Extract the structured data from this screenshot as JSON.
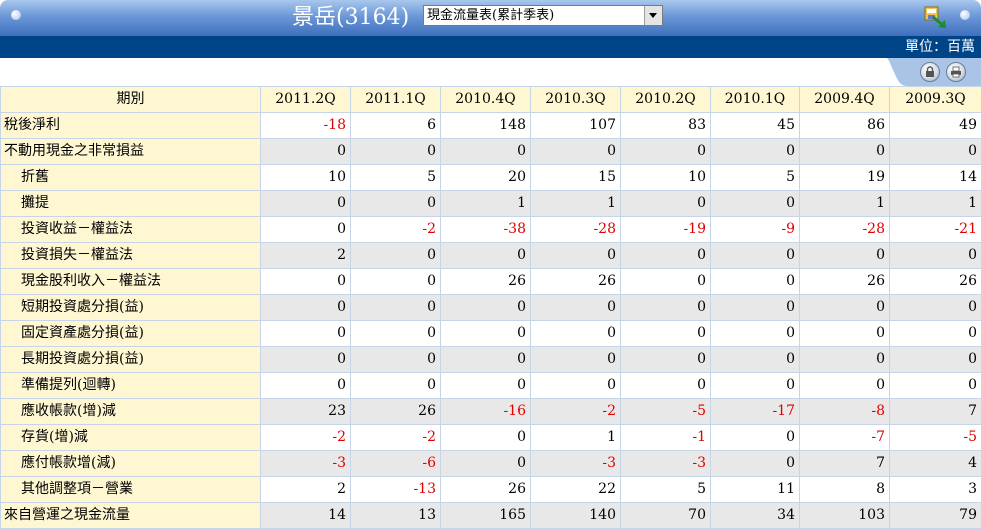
{
  "header": {
    "title": "景岳(3164)",
    "report_select": "現金流量表(累計季表)",
    "unit": "單位：百萬"
  },
  "icons": [
    "export-excel-icon",
    "lock-icon",
    "print-icon"
  ],
  "colors": {
    "negative": "#e00000",
    "header_bg": "#004488",
    "label_bg": "#fff7d2",
    "alt_row": "#e8e8e8"
  },
  "table": {
    "period_header": "期別",
    "columns": [
      "2011.2Q",
      "2011.1Q",
      "2010.4Q",
      "2010.3Q",
      "2010.2Q",
      "2010.1Q",
      "2009.4Q",
      "2009.3Q"
    ],
    "rows": [
      {
        "label": "稅後淨利",
        "indent": false,
        "values": [
          "-18",
          "6",
          "148",
          "107",
          "83",
          "45",
          "86",
          "49"
        ]
      },
      {
        "label": "不動用現金之非常損益",
        "indent": false,
        "values": [
          "0",
          "0",
          "0",
          "0",
          "0",
          "0",
          "0",
          "0"
        ]
      },
      {
        "label": "折舊",
        "indent": true,
        "values": [
          "10",
          "5",
          "20",
          "15",
          "10",
          "5",
          "19",
          "14"
        ]
      },
      {
        "label": "攤提",
        "indent": true,
        "values": [
          "0",
          "0",
          "1",
          "1",
          "0",
          "0",
          "1",
          "1"
        ]
      },
      {
        "label": "投資收益－權益法",
        "indent": true,
        "values": [
          "0",
          "-2",
          "-38",
          "-28",
          "-19",
          "-9",
          "-28",
          "-21"
        ]
      },
      {
        "label": "投資損失－權益法",
        "indent": true,
        "values": [
          "2",
          "0",
          "0",
          "0",
          "0",
          "0",
          "0",
          "0"
        ]
      },
      {
        "label": "現金股利收入－權益法",
        "indent": true,
        "values": [
          "0",
          "0",
          "26",
          "26",
          "0",
          "0",
          "26",
          "26"
        ]
      },
      {
        "label": "短期投資處分損(益)",
        "indent": true,
        "values": [
          "0",
          "0",
          "0",
          "0",
          "0",
          "0",
          "0",
          "0"
        ]
      },
      {
        "label": "固定資產處分損(益)",
        "indent": true,
        "values": [
          "0",
          "0",
          "0",
          "0",
          "0",
          "0",
          "0",
          "0"
        ]
      },
      {
        "label": "長期投資處分損(益)",
        "indent": true,
        "values": [
          "0",
          "0",
          "0",
          "0",
          "0",
          "0",
          "0",
          "0"
        ]
      },
      {
        "label": "準備提列(迴轉)",
        "indent": true,
        "values": [
          "0",
          "0",
          "0",
          "0",
          "0",
          "0",
          "0",
          "0"
        ]
      },
      {
        "label": "應收帳款(增)減",
        "indent": true,
        "values": [
          "23",
          "26",
          "-16",
          "-2",
          "-5",
          "-17",
          "-8",
          "7"
        ]
      },
      {
        "label": "存貨(增)減",
        "indent": true,
        "values": [
          "-2",
          "-2",
          "0",
          "1",
          "-1",
          "0",
          "-7",
          "-5"
        ]
      },
      {
        "label": "應付帳款增(減)",
        "indent": true,
        "values": [
          "-3",
          "-6",
          "0",
          "-3",
          "-3",
          "0",
          "7",
          "4"
        ]
      },
      {
        "label": "其他調整項－營業",
        "indent": true,
        "values": [
          "2",
          "-13",
          "26",
          "22",
          "5",
          "11",
          "8",
          "3"
        ]
      },
      {
        "label": "來自營運之現金流量",
        "indent": false,
        "values": [
          "14",
          "13",
          "165",
          "140",
          "70",
          "34",
          "103",
          "79"
        ]
      }
    ]
  }
}
